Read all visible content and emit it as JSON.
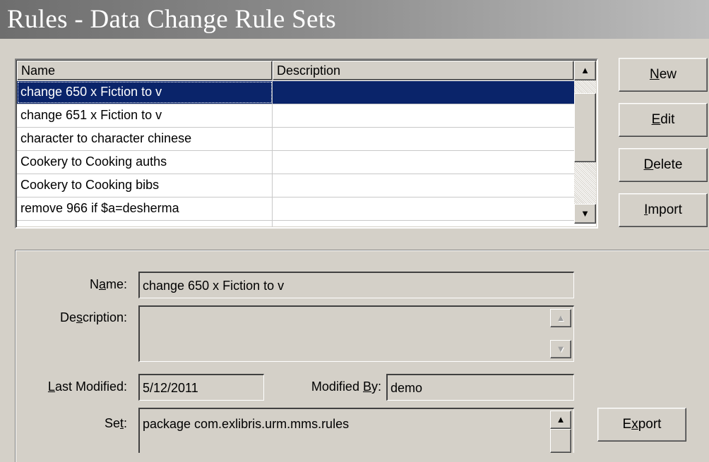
{
  "window": {
    "title": "Rules - Data Change Rule Sets"
  },
  "list": {
    "columns": [
      "Name",
      "Description"
    ],
    "rows": [
      {
        "name": "change 650 x Fiction to v",
        "description": "",
        "selected": true
      },
      {
        "name": "change 651 x Fiction to v",
        "description": ""
      },
      {
        "name": "character to character chinese",
        "description": ""
      },
      {
        "name": "Cookery to Cooking auths",
        "description": ""
      },
      {
        "name": "Cookery to Cooking bibs",
        "description": ""
      },
      {
        "name": "remove 966 if $a=desherma",
        "description": ""
      }
    ],
    "scroll_up_glyph": "▲",
    "scroll_down_glyph": "▼"
  },
  "buttons": {
    "new": {
      "mnemonic": "N",
      "rest": "ew"
    },
    "edit": {
      "mnemonic": "E",
      "rest": "dit"
    },
    "delete": {
      "mnemonic": "D",
      "rest": "elete"
    },
    "import": {
      "mnemonic": "I",
      "rest": "mport"
    },
    "export": {
      "pre": "E",
      "mnemonic": "x",
      "rest": "port"
    }
  },
  "details": {
    "name_label": {
      "pre": "N",
      "mnemonic": "a",
      "rest": "me:"
    },
    "name_value": "change 650 x Fiction to v",
    "description_label": {
      "pre": "De",
      "mnemonic": "s",
      "rest": "cription:"
    },
    "description_value": "",
    "last_modified_label": {
      "pre": "",
      "mnemonic": "L",
      "rest": "ast Modified:"
    },
    "last_modified_value": "5/12/2011",
    "modified_by_label": {
      "pre": "Modified ",
      "mnemonic": "B",
      "rest": "y:"
    },
    "modified_by_value": "demo",
    "set_label": {
      "pre": "Se",
      "mnemonic": "t",
      "rest": ":"
    },
    "set_value": "package com.exlibris.urm.mms.rules"
  }
}
